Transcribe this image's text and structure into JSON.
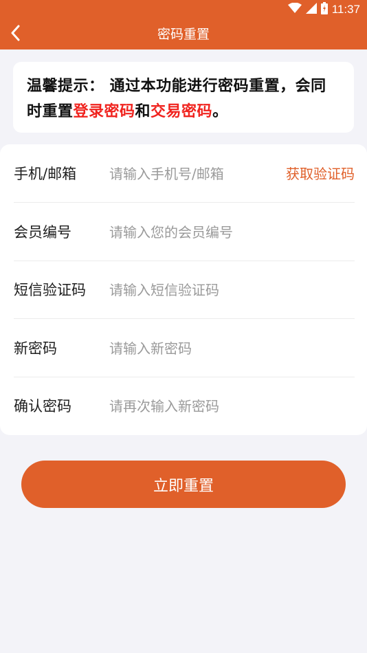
{
  "status_bar": {
    "time": "11:37"
  },
  "header": {
    "title": "密码重置",
    "back_icon": "chevron-left-icon"
  },
  "tip": {
    "prefix": "温馨提示： 通过本功能进行密码重置，会同时重置",
    "highlight_login": "登录密码",
    "connector": "和",
    "highlight_trade": "交易密码",
    "suffix": "。",
    "highlight_color": "#f0231e"
  },
  "form": {
    "rows": [
      {
        "label": "手机/邮箱",
        "placeholder": "请输入手机号/邮箱",
        "value": ""
      },
      {
        "label": "会员编号",
        "placeholder": "请输入您的会员编号",
        "value": ""
      },
      {
        "label": "短信验证码",
        "placeholder": "请输入短信验证码",
        "value": ""
      },
      {
        "label": "新密码",
        "placeholder": "请输入新密码",
        "value": ""
      },
      {
        "label": "确认密码",
        "placeholder": "请再次输入新密码",
        "value": ""
      }
    ],
    "get_code_label": "获取验证码"
  },
  "submit_label": "立即重置",
  "colors": {
    "accent": "#e0602a",
    "background": "#f3f3f8"
  }
}
